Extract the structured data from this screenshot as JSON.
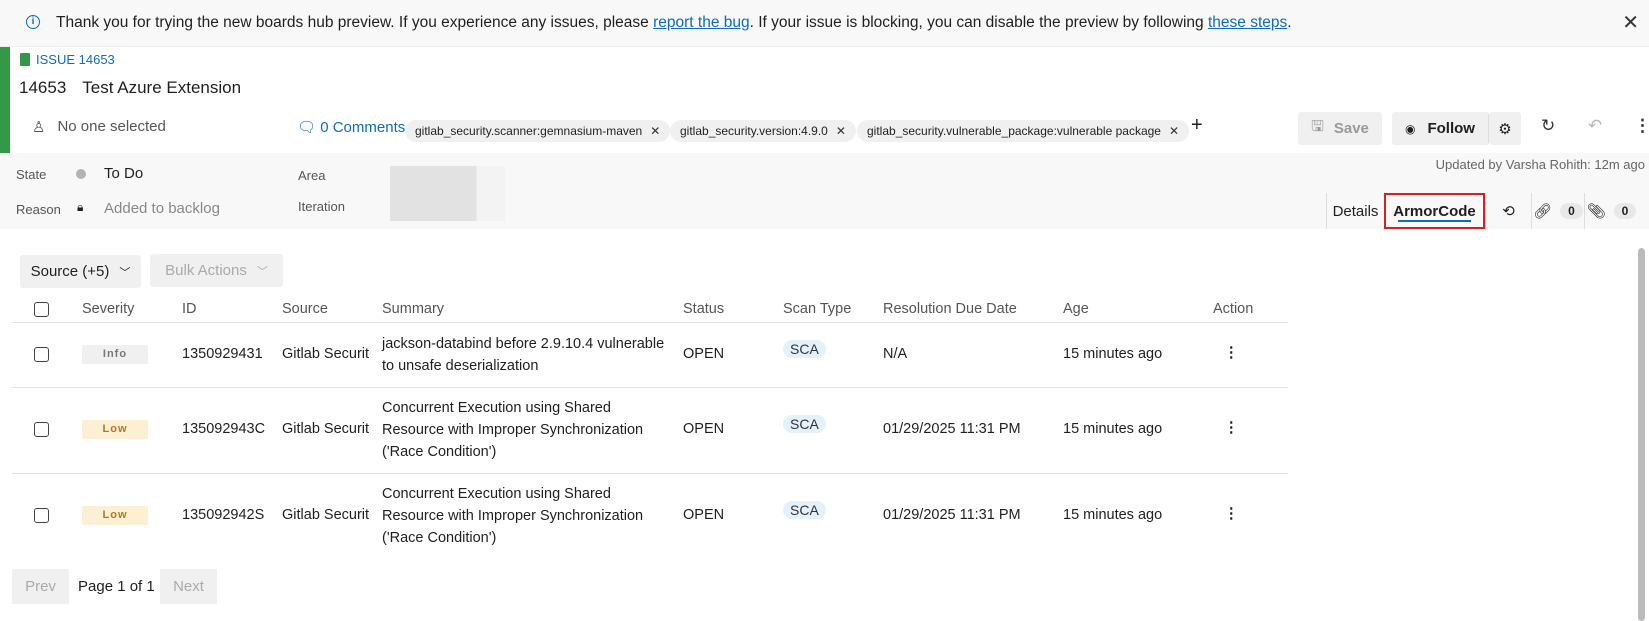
{
  "banner": {
    "pre": "Thank you for trying the new boards hub preview. If you experience any issues, please ",
    "link1": "report the bug",
    "mid": ". If your issue is blocking, you can disable the preview by following ",
    "link2": "these steps",
    "post": "."
  },
  "work_item": {
    "type": "ISSUE 14653",
    "id": "14653",
    "title": "Test Azure Extension",
    "assignee": "No one selected",
    "comments": "0 Comments",
    "tags": [
      "gitlab_security.scanner:gemnasium-maven",
      "gitlab_security.version:4.9.0",
      "gitlab_security.vulnerable_package:vulnerable package"
    ]
  },
  "toolbar": {
    "save": "Save",
    "follow": "Follow"
  },
  "fields": {
    "state_label": "State",
    "state": "To Do",
    "reason_label": "Reason",
    "reason": "Added to backlog",
    "area_label": "Area",
    "iteration_label": "Iteration",
    "updated": "Updated by Varsha Rohith: 12m ago"
  },
  "tabs": {
    "details": "Details",
    "armorcode": "ArmorCode",
    "links_count": "0",
    "attachments_count": "0"
  },
  "filters": {
    "source": "Source (+5)",
    "bulk": "Bulk Actions"
  },
  "table": {
    "headers": [
      "Severity",
      "ID",
      "Source",
      "Summary",
      "Status",
      "Scan Type",
      "Resolution Due Date",
      "Age",
      "Action"
    ],
    "rows": [
      {
        "severity": "Info",
        "id": "1350929431",
        "source": "Gitlab Securit",
        "summary": "jackson-databind before 2.9.10.4 vulnerable to unsafe deserialization",
        "status": "OPEN",
        "scan": "SCA",
        "due": "N/A",
        "age": "15 minutes ago"
      },
      {
        "severity": "Low",
        "id": "135092943C",
        "source": "Gitlab Securit",
        "summary": "Concurrent Execution using Shared Resource with Improper Synchronization ('Race Condition')",
        "status": "OPEN",
        "scan": "SCA",
        "due": "01/29/2025 11:31 PM",
        "age": "15 minutes ago"
      },
      {
        "severity": "Low",
        "id": "135092942S",
        "source": "Gitlab Securit",
        "summary": "Concurrent Execution using Shared Resource with Improper Synchronization ('Race Condition')",
        "status": "OPEN",
        "scan": "SCA",
        "due": "01/29/2025 11:31 PM",
        "age": "15 minutes ago"
      }
    ]
  },
  "pagination": {
    "prev": "Prev",
    "label": "Page 1 of 1",
    "next": "Next"
  },
  "colors": {
    "accent": "#0f6cbd",
    "issue_green": "#339947",
    "info_bg": "#f0f0f0",
    "low_bg": "#fdefd3",
    "low_text": "#b07a1a",
    "highlight": "#d92020"
  }
}
